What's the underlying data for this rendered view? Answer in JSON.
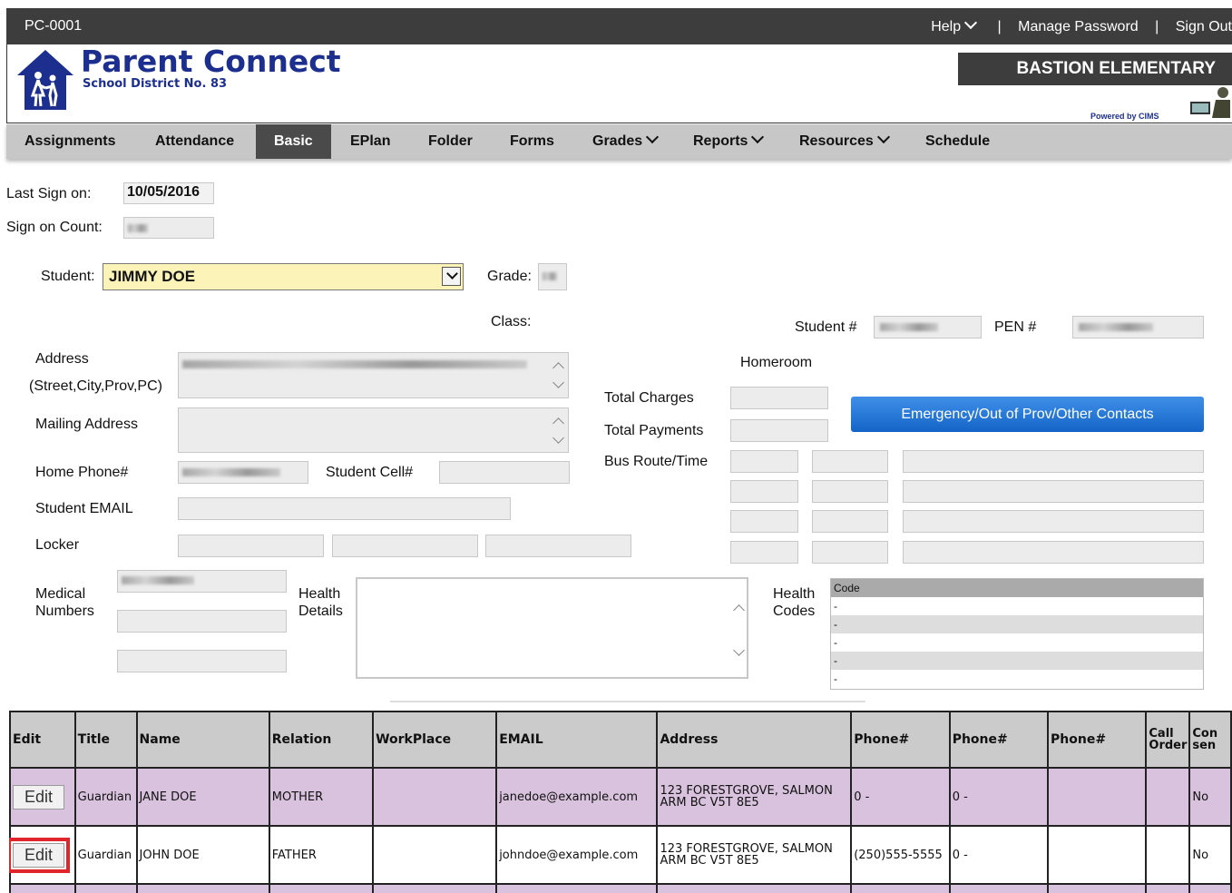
{
  "topbar": {
    "code": "PC-0001",
    "help": "Help",
    "sep1": "|",
    "manage": "Manage Password",
    "sep2": "|",
    "signout": "Sign Out"
  },
  "brand": {
    "title": "Parent Connect",
    "district": "School District No. 83",
    "school": "BASTION ELEMENTARY",
    "powered": "Powered by CIMS"
  },
  "nav": [
    {
      "label": "Assignments"
    },
    {
      "label": "Attendance"
    },
    {
      "label": "Basic"
    },
    {
      "label": "EPlan"
    },
    {
      "label": "Folder"
    },
    {
      "label": "Forms"
    },
    {
      "label": "Grades"
    },
    {
      "label": "Reports"
    },
    {
      "label": "Resources"
    },
    {
      "label": "Schedule"
    }
  ],
  "form": {
    "last_sign_label": "Last Sign on:",
    "last_sign_value": "10/05/2016",
    "count_label": "Sign on Count:",
    "student_label": "Student:",
    "student_value": "JIMMY DOE",
    "grade_label": "Grade:",
    "class_label": "Class:",
    "student_num_label": "Student #",
    "pen_label": "PEN #",
    "address_label": "Address",
    "address_sub": "(Street,City,Prov,PC)",
    "homeroom_label": "Homeroom",
    "total_charges": "Total Charges",
    "total_payments": "Total Payments",
    "emergency_button": "Emergency/Out of Prov/Other Contacts",
    "mailing_label": "Mailing Address",
    "bus_label": "Bus Route/Time",
    "home_phone_label": "Home Phone#",
    "student_cell_label": "Student Cell#",
    "email_label": "Student EMAIL",
    "locker_label": "Locker",
    "medical_label1": "Medical",
    "medical_label2": "Numbers",
    "health_details1": "Health",
    "health_details2": "Details",
    "health_codes1": "Health",
    "health_codes2": "Codes",
    "code_header": "Code",
    "codes": [
      "-",
      "-",
      "-",
      "-",
      "-"
    ]
  },
  "table": {
    "headers": [
      "Edit",
      "Title",
      "Name",
      "Relation",
      "WorkPlace",
      "EMAIL",
      "Address",
      "Phone#",
      "Phone#",
      "Phone#",
      "Call Order",
      "Con sen"
    ],
    "rows": [
      {
        "edit": "Edit",
        "title": "Guardian",
        "name": "JANE DOE",
        "relation": "MOTHER",
        "workplace": "",
        "email": "janedoe@example.com",
        "address": "123 FORESTGROVE, SALMON ARM BC V5T 8E5",
        "phone1": "0 -",
        "phone2": "0 -",
        "phone3": "",
        "call": "",
        "consent": "No"
      },
      {
        "edit": "Edit",
        "title": "Guardian",
        "name": "JOHN DOE",
        "relation": "FATHER",
        "workplace": "",
        "email": "johndoe@example.com",
        "address": "123 FORESTGROVE, SALMON ARM BC V5T 8E5",
        "phone1": "(250)555-5555",
        "phone2": "0 -",
        "phone3": "",
        "call": "",
        "consent": "No"
      }
    ]
  },
  "colors": {
    "brand": "#1c2f8f",
    "topbar": "#3d3d3d",
    "nav": "#c7c7c7",
    "highlight": "#e0262a",
    "button": "#1464c8"
  }
}
